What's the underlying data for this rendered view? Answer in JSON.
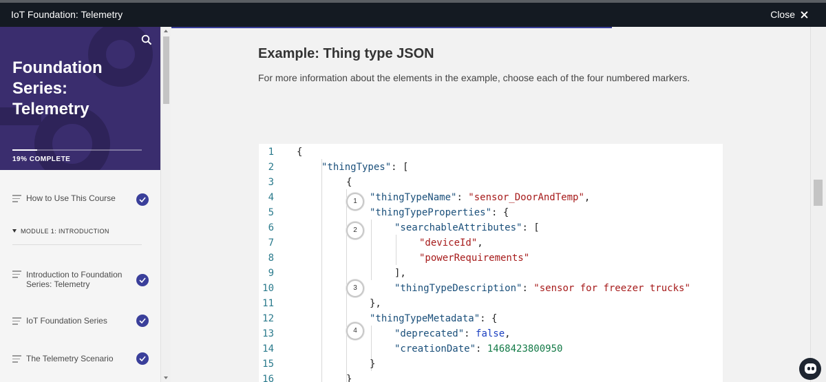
{
  "window": {
    "title": "IoT Foundation: Telemetry",
    "close_label": "Close"
  },
  "sidebar": {
    "course_title": "Foundation Series: Telemetry",
    "progress": {
      "percent": 19,
      "label": "19% COMPLETE"
    },
    "items": [
      {
        "label": "How to Use This Course",
        "completed": true
      },
      {
        "label": "Introduction to Foundation Series: Telemetry",
        "completed": true
      },
      {
        "label": "IoT Foundation Series",
        "completed": true
      },
      {
        "label": "The Telemetry Scenario",
        "completed": true
      }
    ],
    "module_label": "MODULE 1: INTRODUCTION"
  },
  "main": {
    "heading": "Example: Thing type JSON",
    "intro": "For more information about the elements in the example, choose each of the four numbered markers.",
    "markers": [
      "1",
      "2",
      "3",
      "4"
    ],
    "code_lines": [
      {
        "n": "1",
        "tokens": [
          {
            "t": "{",
            "c": "p"
          }
        ]
      },
      {
        "n": "2",
        "tokens": [
          {
            "t": "\"thingTypes\"",
            "c": "k"
          },
          {
            "t": ": [",
            "c": "p"
          }
        ]
      },
      {
        "n": "3",
        "tokens": [
          {
            "t": "{",
            "c": "p"
          }
        ]
      },
      {
        "n": "4",
        "tokens": [
          {
            "t": "\"thingTypeName\"",
            "c": "k"
          },
          {
            "t": ": ",
            "c": "p"
          },
          {
            "t": "\"sensor_DoorAndTemp\"",
            "c": "s"
          },
          {
            "t": ",",
            "c": "p"
          }
        ]
      },
      {
        "n": "5",
        "tokens": [
          {
            "t": "\"thingTypeProperties\"",
            "c": "k"
          },
          {
            "t": ": {",
            "c": "p"
          }
        ]
      },
      {
        "n": "6",
        "tokens": [
          {
            "t": "\"searchableAttributes\"",
            "c": "k"
          },
          {
            "t": ": [",
            "c": "p"
          }
        ]
      },
      {
        "n": "7",
        "tokens": [
          {
            "t": "\"deviceId\"",
            "c": "s"
          },
          {
            "t": ",",
            "c": "p"
          }
        ]
      },
      {
        "n": "8",
        "tokens": [
          {
            "t": "\"powerRequirements\"",
            "c": "s"
          }
        ]
      },
      {
        "n": "9",
        "tokens": [
          {
            "t": "],",
            "c": "p"
          }
        ]
      },
      {
        "n": "10",
        "tokens": [
          {
            "t": "\"thingTypeDescription\"",
            "c": "k"
          },
          {
            "t": ": ",
            "c": "p"
          },
          {
            "t": "\"sensor for freezer trucks\"",
            "c": "s"
          }
        ]
      },
      {
        "n": "11",
        "tokens": [
          {
            "t": "},",
            "c": "p"
          }
        ]
      },
      {
        "n": "12",
        "tokens": [
          {
            "t": "\"thingTypeMetadata\"",
            "c": "k"
          },
          {
            "t": ": {",
            "c": "p"
          }
        ]
      },
      {
        "n": "13",
        "tokens": [
          {
            "t": "\"deprecated\"",
            "c": "k"
          },
          {
            "t": ": ",
            "c": "p"
          },
          {
            "t": "false",
            "c": "b"
          },
          {
            "t": ",",
            "c": "p"
          }
        ]
      },
      {
        "n": "14",
        "tokens": [
          {
            "t": "\"creationDate\"",
            "c": "k"
          },
          {
            "t": ": ",
            "c": "p"
          },
          {
            "t": "1468423800950",
            "c": "n"
          }
        ]
      },
      {
        "n": "15",
        "tokens": [
          {
            "t": "}",
            "c": "p"
          }
        ]
      },
      {
        "n": "16",
        "tokens": [
          {
            "t": "}",
            "c": "p"
          }
        ]
      }
    ]
  },
  "colors": {
    "accent": "#3a3f9a",
    "hero": "#3a2d6e",
    "topbar": "#141a22"
  }
}
